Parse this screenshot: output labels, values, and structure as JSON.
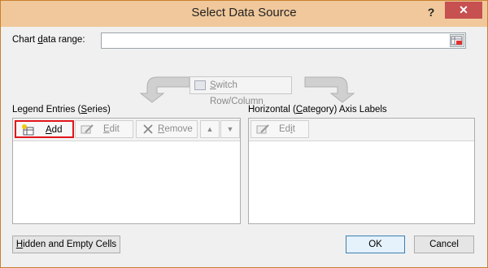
{
  "dialog": {
    "title": "Select Data Source",
    "help_glyph": "?",
    "close_glyph": "✕"
  },
  "chart_range": {
    "label_pre": "Chart ",
    "label_ul": "d",
    "label_post": "ata range:",
    "value": ""
  },
  "switch": {
    "label_pre": "",
    "label_ul": "S",
    "label_post": "witch Row/Column"
  },
  "legend": {
    "label_pre": "Legend Entries (",
    "label_ul": "S",
    "label_post": "eries)",
    "add_pre": "",
    "add_ul": "A",
    "add_post": "dd",
    "edit_pre": "",
    "edit_ul": "E",
    "edit_post": "dit",
    "remove_pre": "",
    "remove_ul": "R",
    "remove_post": "emove",
    "up_glyph": "▲",
    "down_glyph": "▼"
  },
  "axis": {
    "label_pre": "Horizontal (",
    "label_ul": "C",
    "label_post": "ategory) Axis Labels",
    "edit_pre": "Ed",
    "edit_ul": "i",
    "edit_post": "t"
  },
  "footer": {
    "hidden_pre": "",
    "hidden_ul": "H",
    "hidden_post": "idden and Empty Cells",
    "ok": "OK",
    "cancel": "Cancel"
  },
  "colors": {
    "title_bar": "#f0c89b",
    "close_button": "#c75050",
    "highlight": "#e0151b",
    "dialog_bg": "#f0f0f0"
  }
}
